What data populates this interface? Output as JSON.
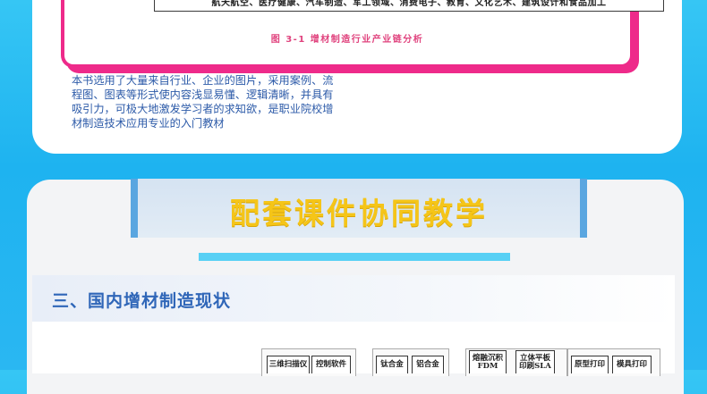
{
  "figure": {
    "industries": "航天航空、医疗健康、汽车制造、军工领域、消费电子、教育、文化艺术、建筑设计和食品加工",
    "caption": "图 3-1 增材制造行业产业链分析"
  },
  "description": "本书选用了大量来自行业、企业的图片，采用案例、流程图、图表等形式使内容浅显易懂、逻辑清晰，并具有吸引力，可极大地激发学习者的求知欲，是职业院校增材制造技术应用专业的入门教材",
  "banner": {
    "title": "配套课件协同教学"
  },
  "section": {
    "title": "三、国内增材制造现状",
    "chips": [
      {
        "line1": "三维扫描仪",
        "line2": ""
      },
      {
        "line1": "控制软件",
        "line2": ""
      },
      {
        "line1": "钛合金",
        "line2": ""
      },
      {
        "line1": "铝合金",
        "line2": ""
      },
      {
        "line1": "熔融沉积",
        "line2": "FDM"
      },
      {
        "line1": "立体平板",
        "line2": "印刷SLA"
      },
      {
        "line1": "原型打印",
        "line2": ""
      },
      {
        "line1": "模具打印",
        "line2": ""
      }
    ]
  },
  "colors": {
    "accent_pink": "#ee2a8a",
    "title_yellow": "#f5c518",
    "text_blue": "#2c5aa8",
    "bg_blue": "#1eb3f0"
  }
}
